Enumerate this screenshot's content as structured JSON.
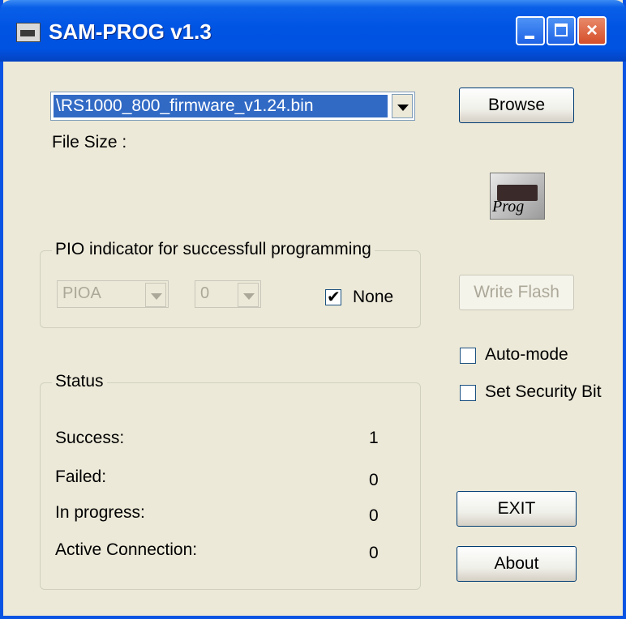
{
  "window": {
    "title": "SAM-PROG v1.3",
    "controls": {
      "minimize": "_",
      "maximize": "□",
      "close": "×"
    }
  },
  "file": {
    "selected_path": "\\RS1000_800_firmware_v1.24.bin",
    "file_size_label": "File Size :"
  },
  "buttons": {
    "browse": "Browse",
    "write_flash": "Write Flash",
    "exit": "EXIT",
    "about": "About"
  },
  "prog_icon_label": "Prog",
  "pio": {
    "legend": "PIO indicator for successfull programming",
    "port_value": "PIOA",
    "pin_value": "0",
    "none_label": "None",
    "none_checked": true
  },
  "options": {
    "auto_mode_label": "Auto-mode",
    "auto_mode_checked": false,
    "security_bit_label": "Set Security Bit",
    "security_bit_checked": false
  },
  "status": {
    "legend": "Status",
    "rows": [
      {
        "label": "Success:",
        "value": "1"
      },
      {
        "label": "Failed:",
        "value": "0"
      },
      {
        "label": "In progress:",
        "value": "0"
      },
      {
        "label": "Active Connection:",
        "value": "0"
      }
    ]
  },
  "colors": {
    "titlebar": "#0054e3",
    "selection": "#316ac5",
    "dialog_bg": "#ece9d8"
  }
}
